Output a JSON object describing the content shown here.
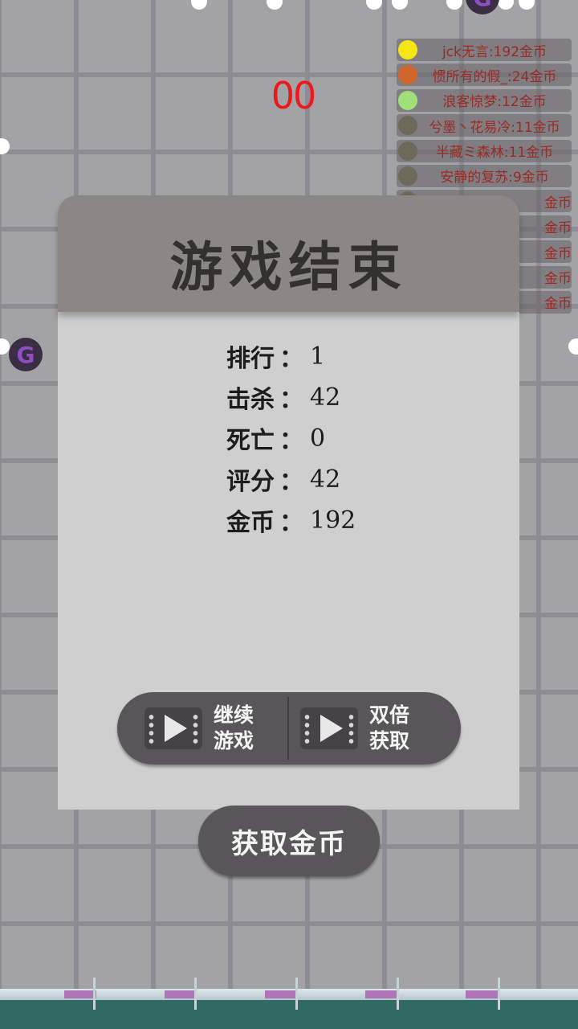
{
  "game": {
    "timer": "00",
    "player_token_letter": "G"
  },
  "leaderboard": [
    {
      "text": "jck无言:192金币",
      "color": "#f5e614"
    },
    {
      "text": "惯所有的假_:24金币",
      "color": "#d2652c"
    },
    {
      "text": "浪客惊梦:12金币",
      "color": "#9fe07a"
    },
    {
      "text": "兮墨丶花易冷:11金币",
      "color": "#6e6a5a"
    },
    {
      "text": "半藏ミ森林:11金币",
      "color": "#6e6a5a"
    },
    {
      "text": "安静的复苏:9金币",
      "color": "#6e6a5a"
    },
    {
      "text": "金币",
      "color": "#6e6a5a"
    },
    {
      "text": "金币",
      "color": "#6e6a5a"
    },
    {
      "text": "金币",
      "color": "#6e6a5a"
    },
    {
      "text": "金币",
      "color": "#6e6a5a"
    },
    {
      "text": "金币",
      "color": "#6e6a5a"
    }
  ],
  "dialog": {
    "title": "游戏结束",
    "stats": [
      {
        "label": "排行",
        "value": "1"
      },
      {
        "label": "击杀",
        "value": "42"
      },
      {
        "label": "死亡",
        "value": "0"
      },
      {
        "label": "评分",
        "value": "42"
      },
      {
        "label": "金币",
        "value": "192"
      }
    ],
    "separator": "：",
    "continue_button": {
      "line1": "继续",
      "line2": "游戏",
      "icon": "video-play-icon"
    },
    "double_button": {
      "line1": "双倍",
      "line2": "获取",
      "icon": "video-play-icon"
    },
    "get_coins_button": "获取金币"
  },
  "colors": {
    "timer": "#ea1a1a",
    "leaderboard_text": "#9c2a22",
    "dialog_header": "#8c8784",
    "dialog_body": "#cfcfcf",
    "button": "#585658",
    "ground": "#2f6a63"
  }
}
